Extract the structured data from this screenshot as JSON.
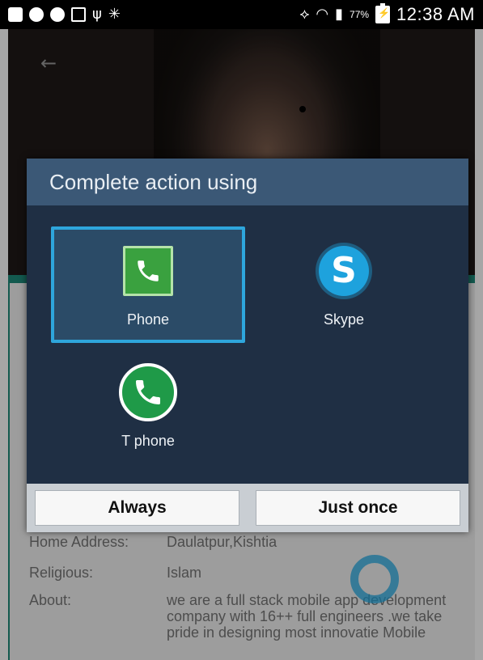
{
  "status_bar": {
    "battery_text": "77%",
    "time": "12:38 AM"
  },
  "dialog": {
    "title": "Complete action using",
    "apps": [
      {
        "label": "Phone",
        "icon": "phone-icon",
        "selected": true
      },
      {
        "label": "Skype",
        "icon": "skype-icon",
        "selected": false
      },
      {
        "label": "T phone",
        "icon": "t-phone-icon",
        "selected": false
      }
    ],
    "buttons": {
      "always": "Always",
      "just_once": "Just once"
    }
  },
  "profile": {
    "rows": [
      {
        "label": "Home Address:",
        "value": "Daulatpur,Kishtia"
      },
      {
        "label": "Religious:",
        "value": "Islam"
      },
      {
        "label": "About:",
        "value": "we are a full stack mobile app development company with 16++ full engineers .we take pride in designing most innovatie Mobile"
      }
    ]
  },
  "colors": {
    "dialog_bg": "#1f2f44",
    "dialog_title_bg": "#3b5876",
    "selection_border": "#2ea6dc",
    "accent_teal": "#1e8b7a"
  }
}
